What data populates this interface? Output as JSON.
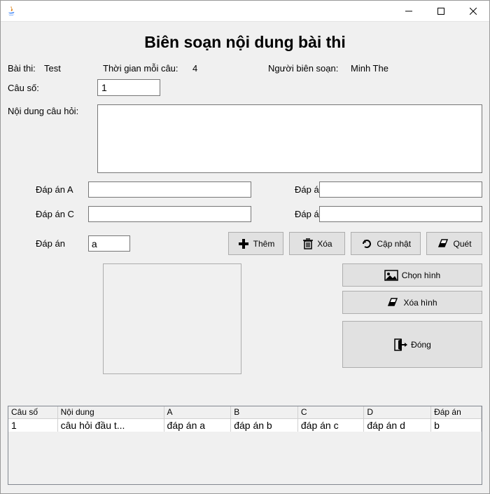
{
  "window": {
    "title": ""
  },
  "heading": "Biên soạn nội dung bài thi",
  "labels": {
    "exam": "Bài thi:",
    "time_per_q": "Thời gian mỗi câu:",
    "author": "Người biên soạn:",
    "q_num": "Câu số:",
    "q_content": "Nội dung câu hỏi:",
    "ans_a": "Đáp án A",
    "ans_b": "Đáp án B",
    "ans_c": "Đáp án C",
    "ans_d": "Đáp án D",
    "correct": "Đáp án"
  },
  "values": {
    "exam": "Test",
    "time_per_q": "4",
    "author": "Minh The",
    "q_num": "1",
    "q_content": "",
    "ans_a": "",
    "ans_b": "",
    "ans_c": "",
    "ans_d": "",
    "correct": "a"
  },
  "buttons": {
    "add": "Thêm",
    "delete": "Xóa",
    "update": "Cập nhật",
    "scan": "Quét",
    "choose_img": "Chọn hình",
    "del_img": "Xóa hình",
    "close": "Đóng"
  },
  "table": {
    "headers": [
      "Câu số",
      "Nội dung",
      "A",
      "B",
      "C",
      "D",
      "Đáp án"
    ],
    "rows": [
      [
        "1",
        "câu hỏi đầu t...",
        "đáp án a",
        "đáp án b",
        "đáp án c",
        "đáp án d",
        "b"
      ]
    ]
  }
}
